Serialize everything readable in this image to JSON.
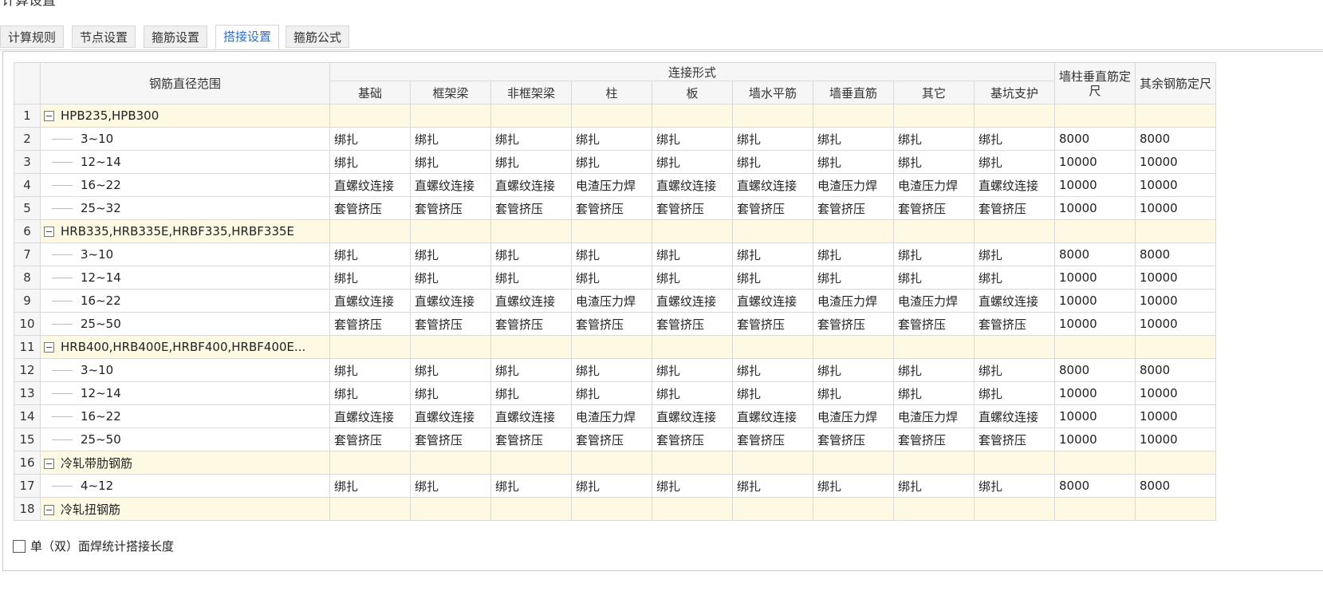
{
  "window": {
    "title": "计算设置"
  },
  "tabs": [
    {
      "label": "计算规则"
    },
    {
      "label": "节点设置"
    },
    {
      "label": "箍筋设置"
    },
    {
      "label": "搭接设置",
      "active": true
    },
    {
      "label": "箍筋公式"
    }
  ],
  "table": {
    "header": {
      "diameter_range": "钢筋直径范围",
      "connection_form": "连接形式",
      "columns": [
        "基础",
        "框架梁",
        "非框架梁",
        "柱",
        "板",
        "墙水平筋",
        "墙垂直筋",
        "其它",
        "基坑支护"
      ],
      "wall_col_fixed": "墙柱垂直筋定尺",
      "other_fixed": "其余钢筋定尺"
    },
    "rows": [
      {
        "no": "1",
        "group": true,
        "name": "HPB235,HPB300",
        "cells": [
          "",
          "",
          "",
          "",
          "",
          "",
          "",
          "",
          "",
          "",
          ""
        ]
      },
      {
        "no": "2",
        "group": false,
        "name": "3~10",
        "cells": [
          "绑扎",
          "绑扎",
          "绑扎",
          "绑扎",
          "绑扎",
          "绑扎",
          "绑扎",
          "绑扎",
          "绑扎",
          "8000",
          "8000"
        ]
      },
      {
        "no": "3",
        "group": false,
        "name": "12~14",
        "cells": [
          "绑扎",
          "绑扎",
          "绑扎",
          "绑扎",
          "绑扎",
          "绑扎",
          "绑扎",
          "绑扎",
          "绑扎",
          "10000",
          "10000"
        ]
      },
      {
        "no": "4",
        "group": false,
        "name": "16~22",
        "cells": [
          "直螺纹连接",
          "直螺纹连接",
          "直螺纹连接",
          "电渣压力焊",
          "直螺纹连接",
          "直螺纹连接",
          "电渣压力焊",
          "电渣压力焊",
          "直螺纹连接",
          "10000",
          "10000"
        ]
      },
      {
        "no": "5",
        "group": false,
        "name": "25~32",
        "cells": [
          "套管挤压",
          "套管挤压",
          "套管挤压",
          "套管挤压",
          "套管挤压",
          "套管挤压",
          "套管挤压",
          "套管挤压",
          "套管挤压",
          "10000",
          "10000"
        ]
      },
      {
        "no": "6",
        "group": true,
        "name": "HRB335,HRB335E,HRBF335,HRBF335E",
        "cells": [
          "",
          "",
          "",
          "",
          "",
          "",
          "",
          "",
          "",
          "",
          ""
        ]
      },
      {
        "no": "7",
        "group": false,
        "name": "3~10",
        "cells": [
          "绑扎",
          "绑扎",
          "绑扎",
          "绑扎",
          "绑扎",
          "绑扎",
          "绑扎",
          "绑扎",
          "绑扎",
          "8000",
          "8000"
        ]
      },
      {
        "no": "8",
        "group": false,
        "name": "12~14",
        "cells": [
          "绑扎",
          "绑扎",
          "绑扎",
          "绑扎",
          "绑扎",
          "绑扎",
          "绑扎",
          "绑扎",
          "绑扎",
          "10000",
          "10000"
        ]
      },
      {
        "no": "9",
        "group": false,
        "name": "16~22",
        "cells": [
          "直螺纹连接",
          "直螺纹连接",
          "直螺纹连接",
          "电渣压力焊",
          "直螺纹连接",
          "直螺纹连接",
          "电渣压力焊",
          "电渣压力焊",
          "直螺纹连接",
          "10000",
          "10000"
        ]
      },
      {
        "no": "10",
        "group": false,
        "name": "25~50",
        "cells": [
          "套管挤压",
          "套管挤压",
          "套管挤压",
          "套管挤压",
          "套管挤压",
          "套管挤压",
          "套管挤压",
          "套管挤压",
          "套管挤压",
          "10000",
          "10000"
        ]
      },
      {
        "no": "11",
        "group": true,
        "name": "HRB400,HRB400E,HRBF400,HRBF400E...",
        "cells": [
          "",
          "",
          "",
          "",
          "",
          "",
          "",
          "",
          "",
          "",
          ""
        ]
      },
      {
        "no": "12",
        "group": false,
        "name": "3~10",
        "cells": [
          "绑扎",
          "绑扎",
          "绑扎",
          "绑扎",
          "绑扎",
          "绑扎",
          "绑扎",
          "绑扎",
          "绑扎",
          "8000",
          "8000"
        ]
      },
      {
        "no": "13",
        "group": false,
        "name": "12~14",
        "cells": [
          "绑扎",
          "绑扎",
          "绑扎",
          "绑扎",
          "绑扎",
          "绑扎",
          "绑扎",
          "绑扎",
          "绑扎",
          "10000",
          "10000"
        ]
      },
      {
        "no": "14",
        "group": false,
        "name": "16~22",
        "cells": [
          "直螺纹连接",
          "直螺纹连接",
          "直螺纹连接",
          "电渣压力焊",
          "直螺纹连接",
          "直螺纹连接",
          "电渣压力焊",
          "电渣压力焊",
          "直螺纹连接",
          "10000",
          "10000"
        ]
      },
      {
        "no": "15",
        "group": false,
        "name": "25~50",
        "cells": [
          "套管挤压",
          "套管挤压",
          "套管挤压",
          "套管挤压",
          "套管挤压",
          "套管挤压",
          "套管挤压",
          "套管挤压",
          "套管挤压",
          "10000",
          "10000"
        ]
      },
      {
        "no": "16",
        "group": true,
        "name": "冷轧带肋钢筋",
        "cells": [
          "",
          "",
          "",
          "",
          "",
          "",
          "",
          "",
          "",
          "",
          ""
        ]
      },
      {
        "no": "17",
        "group": false,
        "name": "4~12",
        "cells": [
          "绑扎",
          "绑扎",
          "绑扎",
          "绑扎",
          "绑扎",
          "绑扎",
          "绑扎",
          "绑扎",
          "绑扎",
          "8000",
          "8000"
        ]
      },
      {
        "no": "18",
        "group": true,
        "name": "冷轧扭钢筋",
        "cells": [
          "",
          "",
          "",
          "",
          "",
          "",
          "",
          "",
          "",
          "",
          ""
        ]
      }
    ]
  },
  "footer": {
    "checkbox_label": "单（双）面焊统计搭接长度"
  }
}
